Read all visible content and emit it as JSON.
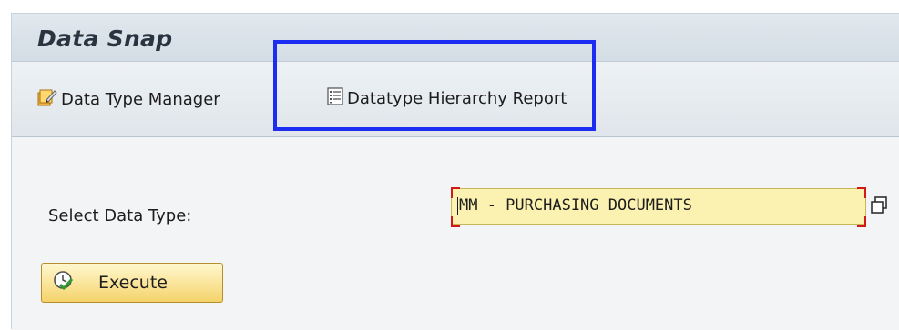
{
  "app": {
    "title": "Data Snap"
  },
  "toolbar": {
    "items": [
      {
        "label": "Data Type Manager",
        "icon": "edit-document-icon"
      },
      {
        "label": "Datatype Hierarchy Report",
        "icon": "report-list-icon"
      }
    ]
  },
  "form": {
    "select_label": "Select Data Type:",
    "data_type_value": "MM - PURCHASING DOCUMENTS",
    "value_help_icon": "value-help-icon",
    "execute_label": "Execute",
    "execute_icon": "execute-clock-icon"
  },
  "colors": {
    "highlight": "#1c2cf0",
    "field_bg": "#fbf1b0",
    "required_marker": "#d21919",
    "button_bg": "#f5d36b"
  }
}
